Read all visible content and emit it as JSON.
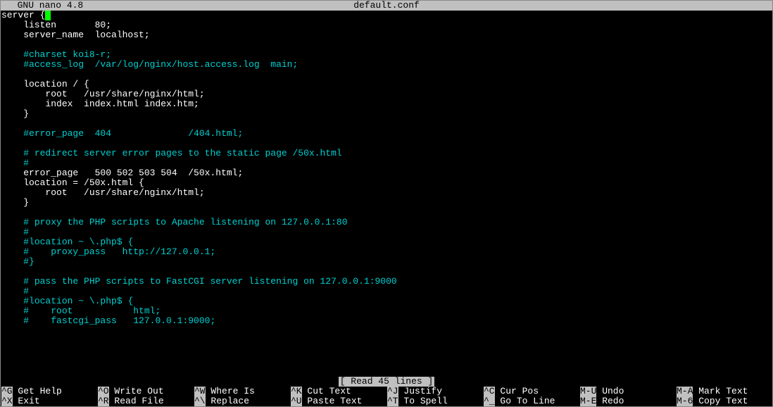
{
  "titlebar": {
    "app": "  GNU nano 4.8",
    "file": "default.conf"
  },
  "editor": {
    "lines": [
      {
        "text": "server {",
        "cursor": true
      },
      {
        "text": "    listen       80;"
      },
      {
        "text": "    server_name  localhost;"
      },
      {
        "text": ""
      },
      {
        "text": "    #charset koi8-r;",
        "cls": "cyan",
        "indent": "    "
      },
      {
        "text": "    #access_log  /var/log/nginx/host.access.log  main;",
        "cls": "cyan",
        "indent": "    "
      },
      {
        "text": ""
      },
      {
        "text": "    location / {"
      },
      {
        "text": "        root   /usr/share/nginx/html;"
      },
      {
        "text": "        index  index.html index.htm;"
      },
      {
        "text": "    }"
      },
      {
        "text": ""
      },
      {
        "text": "    #error_page  404              /404.html;",
        "cls": "cyan",
        "indent": "    "
      },
      {
        "text": ""
      },
      {
        "text": "    # redirect server error pages to the static page /50x.html",
        "cls": "cyan",
        "indent": "    "
      },
      {
        "text": "    #",
        "cls": "cyan",
        "indent": "    "
      },
      {
        "text": "    error_page   500 502 503 504  /50x.html;"
      },
      {
        "text": "    location = /50x.html {"
      },
      {
        "text": "        root   /usr/share/nginx/html;"
      },
      {
        "text": "    }"
      },
      {
        "text": ""
      },
      {
        "text": "    # proxy the PHP scripts to Apache listening on 127.0.0.1:80",
        "cls": "cyan",
        "indent": "    "
      },
      {
        "text": "    #",
        "cls": "cyan",
        "indent": "    "
      },
      {
        "text": "    #location ~ \\.php$ {",
        "cls": "cyan",
        "indent": "    "
      },
      {
        "text": "    #    proxy_pass   http://127.0.0.1;",
        "cls": "cyan",
        "indent": "    "
      },
      {
        "text": "    #}",
        "cls": "cyan",
        "indent": "    "
      },
      {
        "text": ""
      },
      {
        "text": "    # pass the PHP scripts to FastCGI server listening on 127.0.0.1:9000",
        "cls": "cyan",
        "indent": "    "
      },
      {
        "text": "    #",
        "cls": "cyan",
        "indent": "    "
      },
      {
        "text": "    #location ~ \\.php$ {",
        "cls": "cyan",
        "indent": "    "
      },
      {
        "text": "    #    root           html;",
        "cls": "cyan",
        "indent": "    "
      },
      {
        "text": "    #    fastcgi_pass   127.0.0.1:9000;",
        "cls": "cyan",
        "indent": "    "
      }
    ]
  },
  "status": "[ Read 45 lines ]",
  "shortcuts": {
    "row1": [
      {
        "key": "^G",
        "label": " Get Help"
      },
      {
        "key": "^O",
        "label": " Write Out"
      },
      {
        "key": "^W",
        "label": " Where Is"
      },
      {
        "key": "^K",
        "label": " Cut Text"
      },
      {
        "key": "^J",
        "label": " Justify"
      },
      {
        "key": "^C",
        "label": " Cur Pos"
      },
      {
        "key": "M-U",
        "label": " Undo"
      },
      {
        "key": "M-A",
        "label": " Mark Text"
      }
    ],
    "row2": [
      {
        "key": "^X",
        "label": " Exit"
      },
      {
        "key": "^R",
        "label": " Read File"
      },
      {
        "key": "^\\",
        "label": " Replace"
      },
      {
        "key": "^U",
        "label": " Paste Text"
      },
      {
        "key": "^T",
        "label": " To Spell"
      },
      {
        "key": "^_",
        "label": " Go To Line"
      },
      {
        "key": "M-E",
        "label": " Redo"
      },
      {
        "key": "M-6",
        "label": " Copy Text"
      }
    ]
  }
}
